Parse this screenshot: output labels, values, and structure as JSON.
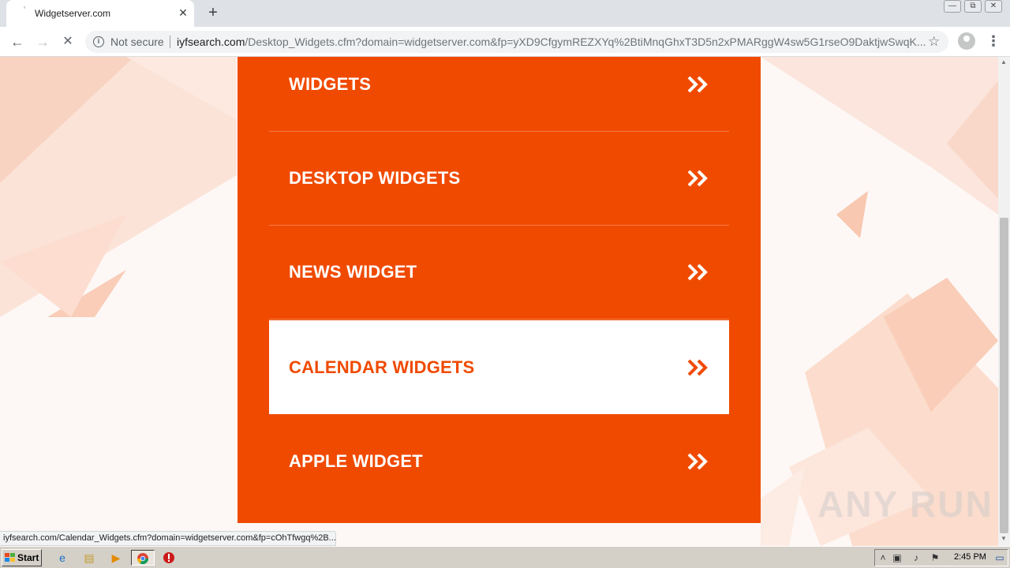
{
  "browser": {
    "tab": {
      "title": "Widgetserver.com",
      "favicon": "loading-favicon",
      "close_icon": "close-icon"
    },
    "new_tab_icon": "plus-icon",
    "window_controls": [
      "minimize-icon",
      "restore-icon",
      "close-icon"
    ],
    "nav": {
      "back_icon": "back-arrow-icon",
      "forward_icon": "forward-arrow-icon",
      "stop_icon": "stop-icon"
    },
    "omnibox": {
      "security_label": "Not secure",
      "url_host": "iyfsearch.com",
      "url_rest": "/Desktop_Widgets.cfm?domain=widgetserver.com&fp=yXD9CfgymREZXYq%2BtiMnqGhxT3D5n2xPMARggW4sw5G1rseO9DaktjwSwqK..."
    },
    "status_url": "iyfsearch.com/Calendar_Widgets.cfm?domain=widgetserver.com&fp=cOhTfwgq%2B..."
  },
  "menu": {
    "accent_color": "#f04a00",
    "items": [
      {
        "label": "WIDGETS",
        "active": false
      },
      {
        "label": "DESKTOP WIDGETS",
        "active": false
      },
      {
        "label": "NEWS WIDGET",
        "active": false
      },
      {
        "label": "CALENDAR WIDGETS",
        "active": true
      },
      {
        "label": "APPLE WIDGET",
        "active": false
      }
    ]
  },
  "watermark": "ANY RUN",
  "taskbar": {
    "start_label": "Start",
    "apps": [
      "internet-explorer-icon",
      "file-explorer-icon",
      "media-player-icon",
      "chrome-icon",
      "stop-sign-icon"
    ],
    "tray_icons": [
      "show-hidden-icons-arrow",
      "network-icon",
      "volume-icon",
      "flag-icon"
    ],
    "clock": "2:45 PM"
  }
}
